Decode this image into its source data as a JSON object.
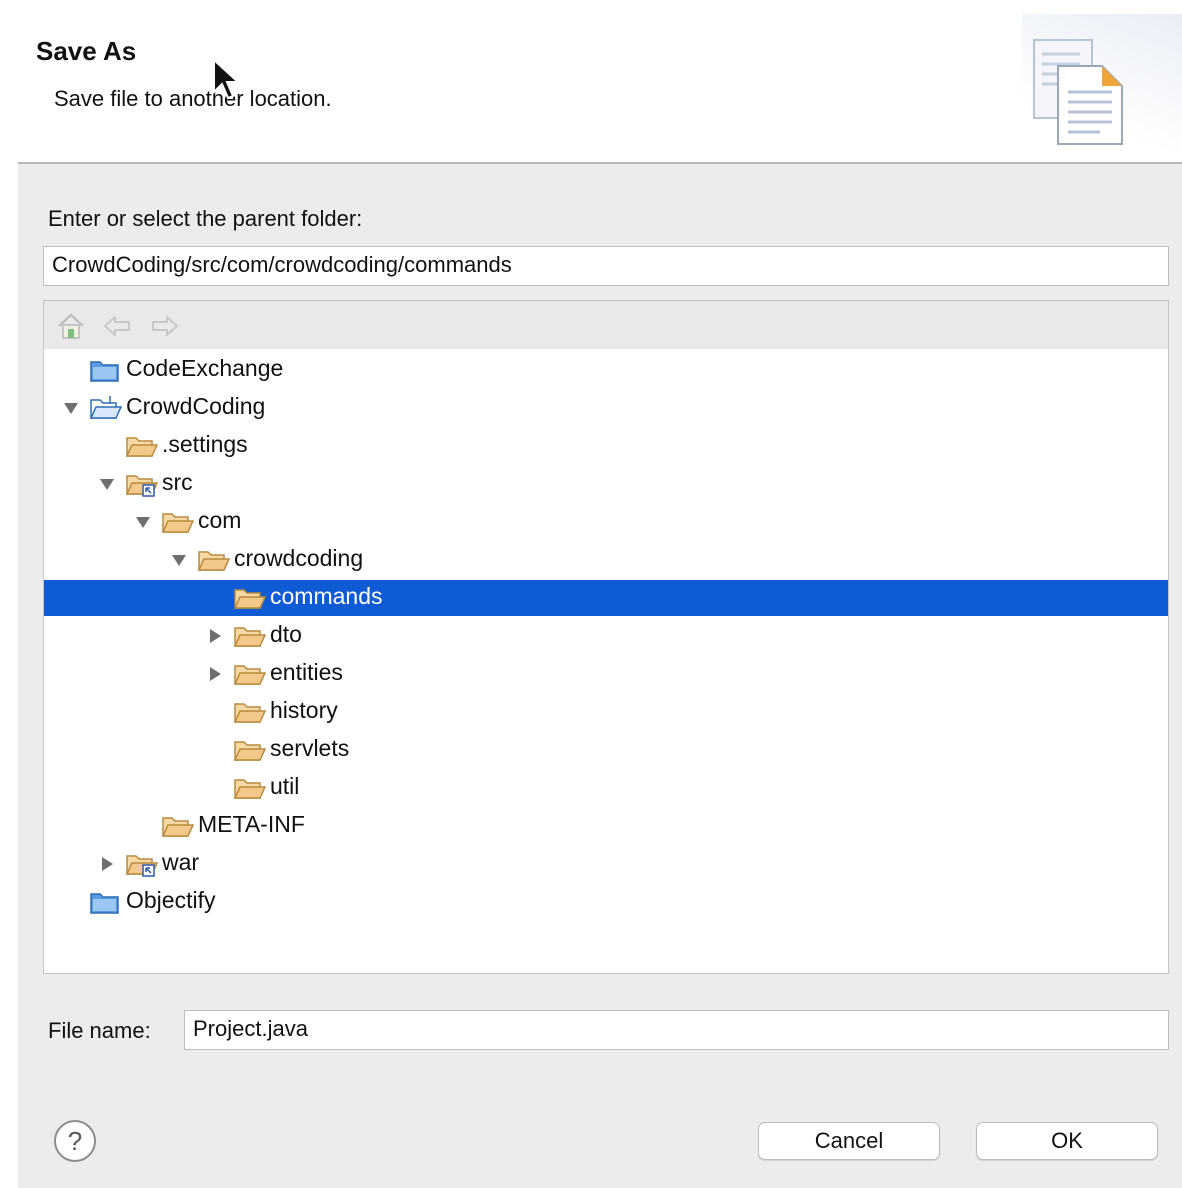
{
  "dialog": {
    "title": "Save As",
    "subtitle": "Save file to another location.",
    "header_icon": "copy-document-icon"
  },
  "folder": {
    "label": "Enter or select the parent folder:",
    "value": "CrowdCoding/src/com/crowdcoding/commands"
  },
  "toolbar": {
    "home_icon": "home-icon",
    "back_icon": "back-arrow-icon",
    "forward_icon": "forward-arrow-icon"
  },
  "tree": {
    "items": [
      {
        "label": "CodeExchange",
        "twisty": "none",
        "icon": "project-closed-icon",
        "depth": 0
      },
      {
        "label": "CrowdCoding",
        "twisty": "expanded",
        "icon": "project-open-icon",
        "depth": 0
      },
      {
        "label": ".settings",
        "twisty": "none",
        "icon": "folder-icon",
        "depth": 1
      },
      {
        "label": "src",
        "twisty": "expanded",
        "icon": "source-folder-icon",
        "depth": 1
      },
      {
        "label": "com",
        "twisty": "expanded",
        "icon": "folder-icon",
        "depth": 2
      },
      {
        "label": "crowdcoding",
        "twisty": "expanded",
        "icon": "folder-icon",
        "depth": 3
      },
      {
        "label": "commands",
        "twisty": "none",
        "icon": "folder-icon",
        "depth": 4,
        "selected": true
      },
      {
        "label": "dto",
        "twisty": "collapsed",
        "icon": "folder-icon",
        "depth": 4
      },
      {
        "label": "entities",
        "twisty": "collapsed",
        "icon": "folder-icon",
        "depth": 4
      },
      {
        "label": "history",
        "twisty": "none",
        "icon": "folder-icon",
        "depth": 4
      },
      {
        "label": "servlets",
        "twisty": "none",
        "icon": "folder-icon",
        "depth": 4
      },
      {
        "label": "util",
        "twisty": "none",
        "icon": "folder-icon",
        "depth": 4
      },
      {
        "label": "META-INF",
        "twisty": "none",
        "icon": "folder-icon",
        "depth": 2
      },
      {
        "label": "war",
        "twisty": "collapsed",
        "icon": "source-folder-icon",
        "depth": 1
      },
      {
        "label": "Objectify",
        "twisty": "none",
        "icon": "project-closed-icon",
        "depth": 0
      }
    ]
  },
  "filename": {
    "label": "File name:",
    "value": "Project.java"
  },
  "buttons": {
    "help_icon": "help-icon",
    "cancel": "Cancel",
    "ok": "OK"
  },
  "colors": {
    "selection": "#0f5bd6",
    "folder": "#f3c98a",
    "project": "#4a90d9"
  }
}
